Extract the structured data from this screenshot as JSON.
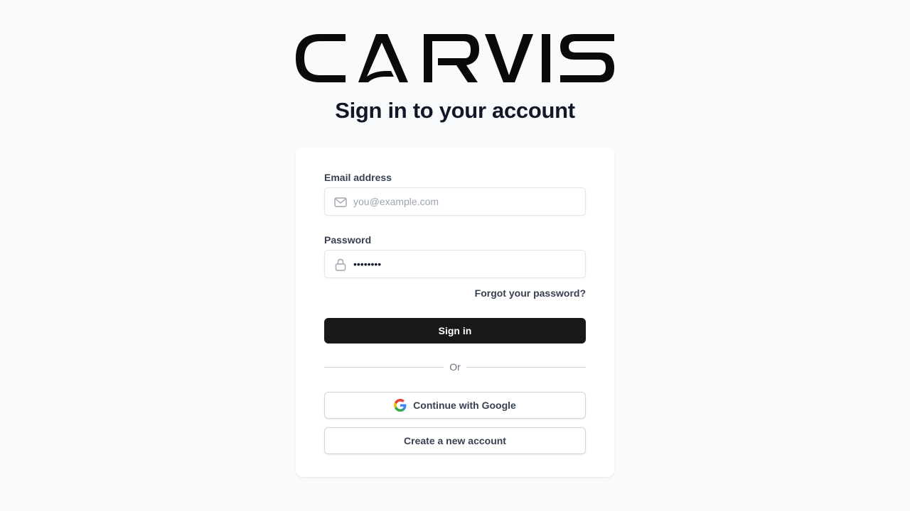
{
  "brand": {
    "logo_text": "CARVIS"
  },
  "page": {
    "title": "Sign in to your account"
  },
  "form": {
    "email": {
      "label": "Email address",
      "placeholder": "you@example.com",
      "icon": "mail-icon"
    },
    "password": {
      "label": "Password",
      "value": "password",
      "icon": "lock-icon"
    },
    "forgot_label": "Forgot your password?",
    "submit_label": "Sign in",
    "divider_label": "Or",
    "google_label": "Continue with Google",
    "google_icon": "google-icon",
    "create_label": "Create a new account"
  },
  "colors": {
    "background": "#f8fafc",
    "primary_button": "#18181b",
    "text_dark": "#111827",
    "text_muted": "#374151"
  }
}
